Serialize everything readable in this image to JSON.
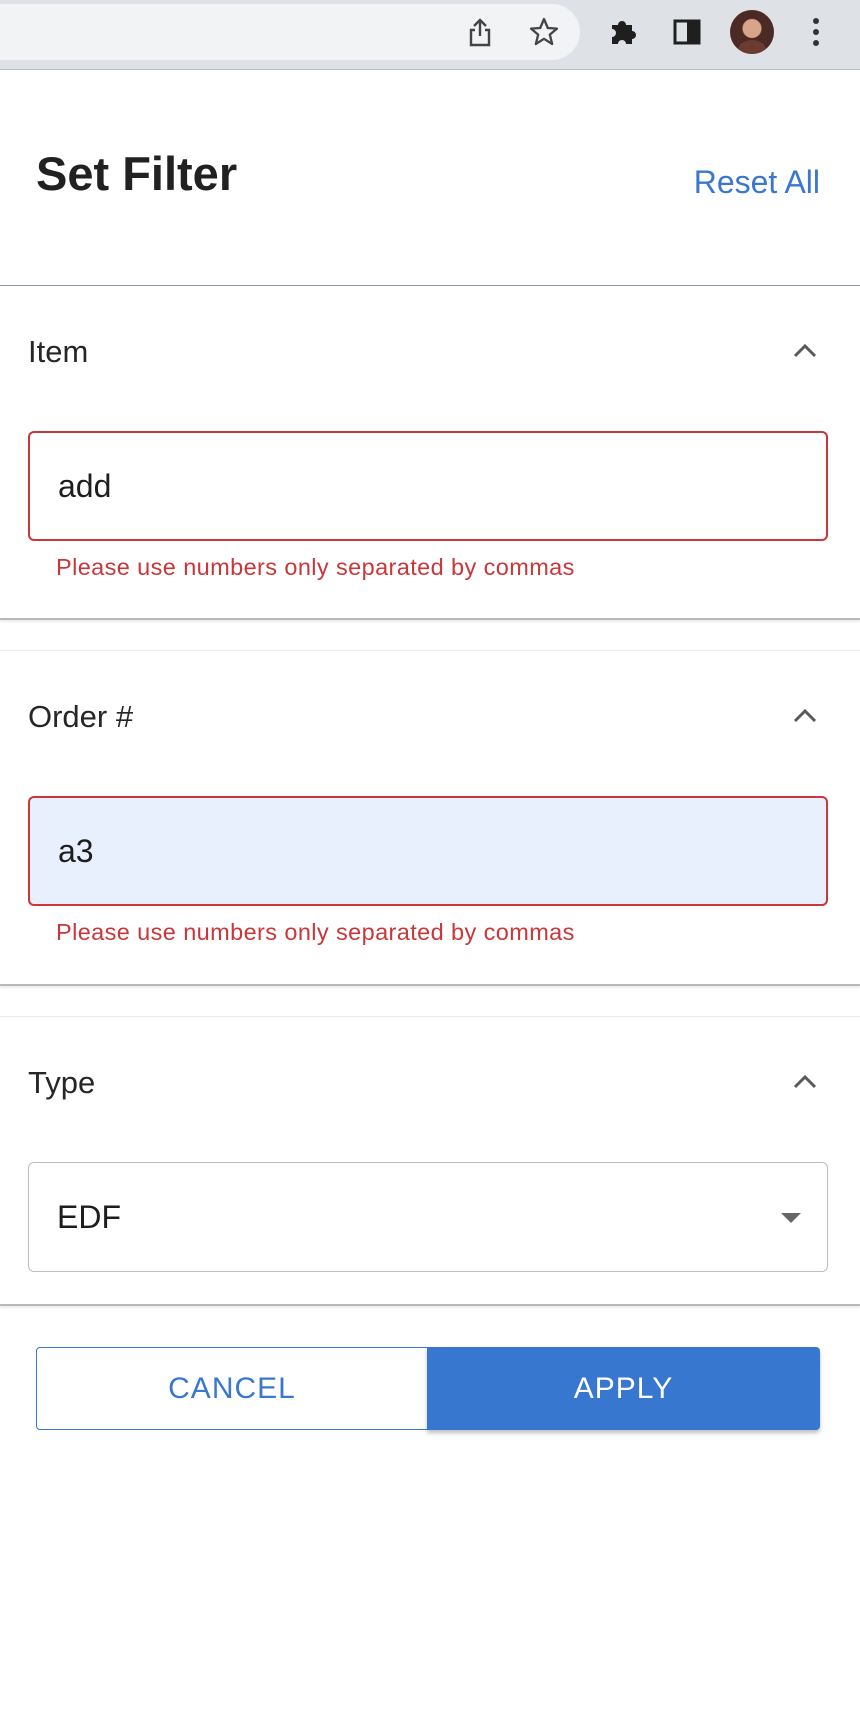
{
  "browser": {
    "icons": [
      "share-icon",
      "bookmark-star-icon",
      "extensions-puzzle-icon",
      "side-panel-icon",
      "profile-avatar",
      "more-vert-icon"
    ]
  },
  "header": {
    "title": "Set Filter",
    "reset_label": "Reset All"
  },
  "sections": {
    "item": {
      "label": "Item",
      "value": "add",
      "error": "Please use numbers only separated by commas"
    },
    "order": {
      "label": "Order #",
      "value": "a3",
      "error": "Please use numbers only separated by commas"
    },
    "type": {
      "label": "Type",
      "selected": "EDF"
    }
  },
  "actions": {
    "cancel_label": "CANCEL",
    "apply_label": "APPLY"
  },
  "colors": {
    "accent": "#3a77d0",
    "error": "#c9373a",
    "autofill_bg": "#e8f0fe"
  }
}
